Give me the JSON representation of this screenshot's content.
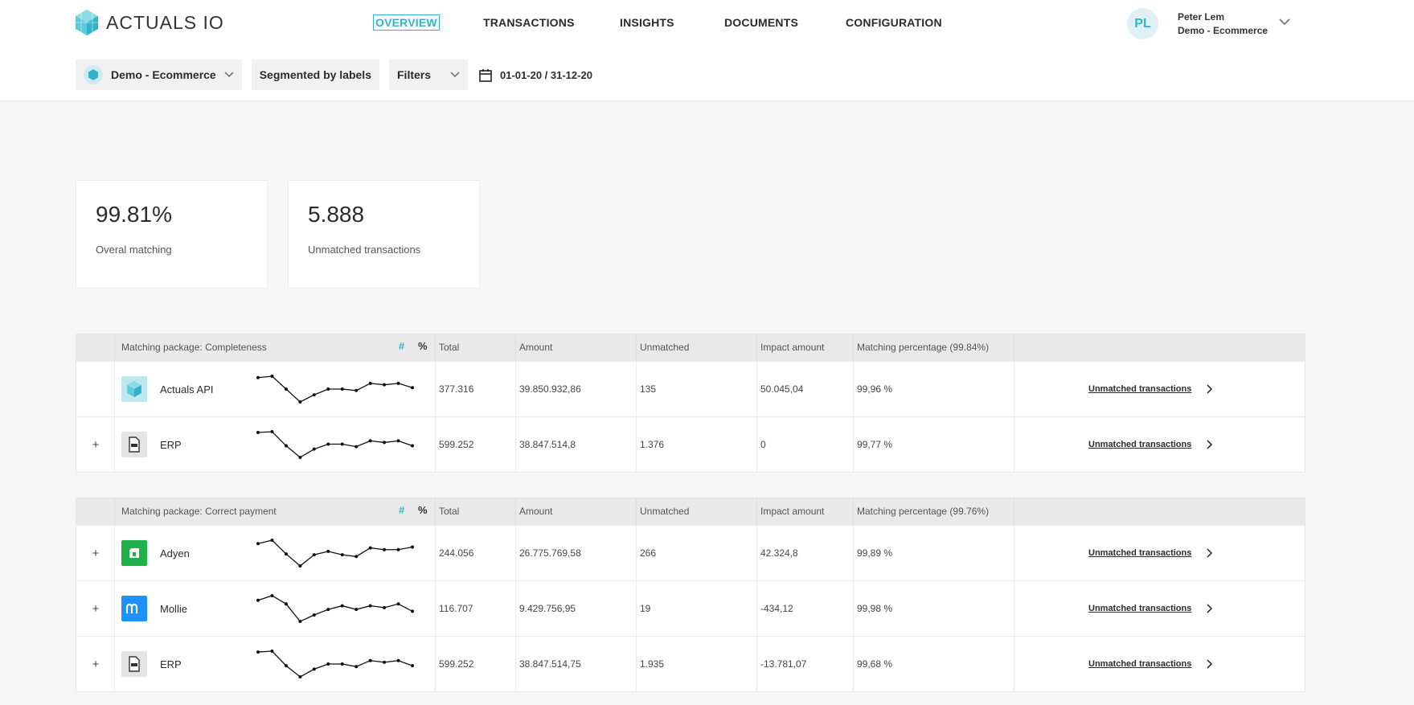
{
  "app": {
    "brand": "ACTUALS IO"
  },
  "nav": [
    {
      "label": "OVERVIEW",
      "active": true
    },
    {
      "label": "TRANSACTIONS",
      "active": false
    },
    {
      "label": "INSIGHTS",
      "active": false
    },
    {
      "label": "DOCUMENTS",
      "active": false
    },
    {
      "label": "CONFIGURATION",
      "active": false
    }
  ],
  "user": {
    "initials": "PL",
    "name": "Peter Lem",
    "org": "Demo - Ecommerce"
  },
  "toolbar": {
    "workspace": "Demo - Ecommerce",
    "segment": "Segmented by labels",
    "filters": "Filters",
    "date_range": "01-01-20 / 31-12-20"
  },
  "kpis": [
    {
      "value": "99.81%",
      "label": "Overal matching"
    },
    {
      "value": "5.888",
      "label": "Unmatched transactions"
    }
  ],
  "colors": {
    "accent": "#33b3c9",
    "adyen": "#1eb04a",
    "mollie": "#1e90ff"
  },
  "tables": [
    {
      "package": "Matching package: Completeness",
      "hash_label": "#",
      "pct_label": "%",
      "columns": [
        "Total",
        "Amount",
        "Unmatched",
        "Impact amount",
        "Matching percentage (99.84%)"
      ],
      "rows": [
        {
          "expand": "",
          "icon": "actuals-logo-icon",
          "name": "Actuals API",
          "total": "377.316",
          "amount": "39.850.932,86",
          "unmatched": "135",
          "impact": "50.045,04",
          "pct": "99,96 %",
          "link": "Unmatched transactions",
          "trend": [
            7,
            6,
            15,
            24,
            19,
            15,
            15,
            16,
            11,
            12,
            11,
            14
          ]
        },
        {
          "expand": "+",
          "icon": "erp-file-icon",
          "name": "ERP",
          "total": "599.252",
          "amount": "38.847.514,8",
          "unmatched": "1.376",
          "impact": "0",
          "pct": "99,77 %",
          "link": "Unmatched transactions",
          "trend": [
            8,
            7,
            24,
            38,
            28,
            22,
            22,
            25,
            18,
            20,
            18,
            24
          ]
        }
      ]
    },
    {
      "package": "Matching package: Correct payment",
      "hash_label": "#",
      "pct_label": "%",
      "columns": [
        "Total",
        "Amount",
        "Unmatched",
        "Impact amount",
        "Matching percentage (99.76%)"
      ],
      "rows": [
        {
          "expand": "+",
          "icon": "adyen-logo-icon",
          "name": "Adyen",
          "total": "244.056",
          "amount": "26.775.769,58",
          "unmatched": "266",
          "impact": "42.324,8",
          "pct": "99,89 %",
          "link": "Unmatched transactions",
          "trend": [
            10,
            6,
            22,
            36,
            23,
            19,
            23,
            25,
            15,
            17,
            17,
            14
          ]
        },
        {
          "expand": "+",
          "icon": "mollie-logo-icon",
          "name": "Mollie",
          "total": "116.707",
          "amount": "9.429.756,95",
          "unmatched": "19",
          "impact": "-434,12",
          "pct": "99,98 %",
          "link": "Unmatched transactions",
          "trend": [
            12,
            7,
            16,
            35,
            28,
            22,
            18,
            22,
            18,
            20,
            16,
            24
          ]
        },
        {
          "expand": "+",
          "icon": "erp-file-icon",
          "name": "ERP",
          "total": "599.252",
          "amount": "38.847.514,75",
          "unmatched": "1.935",
          "impact": "-13.781,07",
          "pct": "99,68 %",
          "link": "Unmatched transactions",
          "trend": [
            8,
            7,
            24,
            37,
            28,
            22,
            22,
            25,
            18,
            20,
            18,
            24
          ]
        }
      ]
    }
  ]
}
